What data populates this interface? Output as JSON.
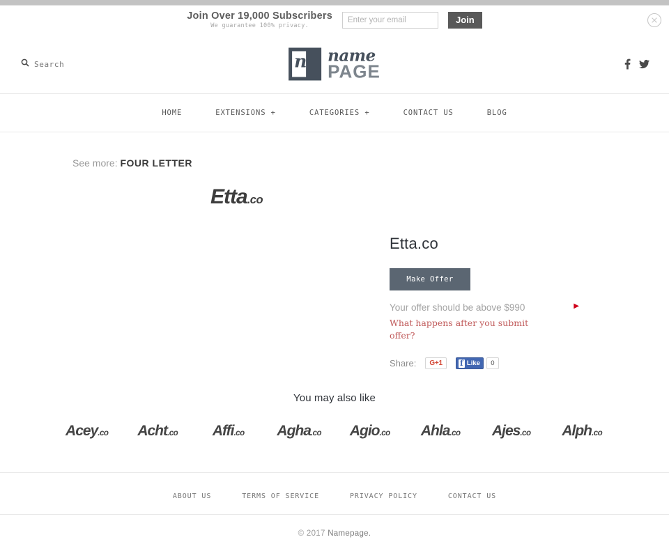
{
  "subscribe_bar": {
    "title": "Join Over 19,000 Subscribers",
    "subtitle": "We guarantee 100% privacy.",
    "email_placeholder": "Enter your email",
    "email_value": "",
    "join_label": "Join",
    "close_icon": "close-circle-icon"
  },
  "masthead": {
    "search_label": "Search",
    "search_icon": "search-icon",
    "logo": {
      "mark_letter": "n",
      "name": "name",
      "page": "PAGE"
    },
    "social": [
      {
        "name": "facebook",
        "glyph": "f"
      },
      {
        "name": "twitter",
        "glyph": "ᵗ"
      }
    ]
  },
  "main_nav": [
    {
      "label": "HOME"
    },
    {
      "label": "EXTENSIONS +"
    },
    {
      "label": "CATEGORIES +"
    },
    {
      "label": "CONTACT US"
    },
    {
      "label": "BLOG"
    }
  ],
  "see_more": {
    "prefix": "See more:",
    "category": "FOUR LETTER"
  },
  "product": {
    "wordmark_name": "Etta",
    "wordmark_tld": ".co",
    "title": "Etta.co",
    "offer_button": "Make Offer",
    "offer_note": "Your offer should be above $990",
    "offer_arrow": "▶",
    "offer_link": "What happens after you submit offer?",
    "share_label": "Share:",
    "gplus_label": "G+1",
    "facebook_like_label": "Like",
    "facebook_like_count": "0"
  },
  "also_like": {
    "title": "You may also like",
    "items": [
      {
        "name": "Acey",
        "tld": ".co"
      },
      {
        "name": "Acht",
        "tld": ".co"
      },
      {
        "name": "Affi",
        "tld": ".co"
      },
      {
        "name": "Agha",
        "tld": ".co"
      },
      {
        "name": "Agio",
        "tld": ".co"
      },
      {
        "name": "Ahla",
        "tld": ".co"
      },
      {
        "name": "Ajes",
        "tld": ".co"
      },
      {
        "name": "Alph",
        "tld": ".co"
      }
    ]
  },
  "footer": {
    "links": [
      {
        "label": "ABOUT US"
      },
      {
        "label": "TERMS OF SERVICE"
      },
      {
        "label": "PRIVACY POLICY"
      },
      {
        "label": "CONTACT US"
      }
    ],
    "copyright_prefix": "© 2017 ",
    "copyright_brand": "Namepage."
  },
  "colors": {
    "accent_button": "#5b6672",
    "logo_dark": "#46505c",
    "link_red": "#c05a5a",
    "arrow_red": "#d0021b",
    "facebook_blue": "#4267b2",
    "gplus_red": "#d34836"
  }
}
